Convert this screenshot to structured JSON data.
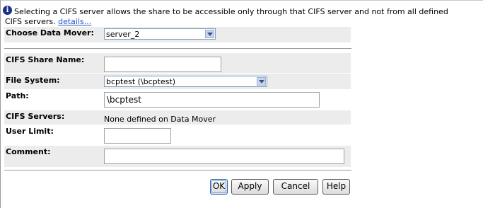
{
  "info": {
    "text_line1": "Selecting a CIFS server allows the share to be accessible only through that CIFS server and not from all defined",
    "text_line2": "CIFS servers.",
    "details_link": "details..."
  },
  "form": {
    "data_mover": {
      "label": "Choose Data Mover:",
      "value": "server_2"
    },
    "share_name": {
      "label": "CIFS Share Name:",
      "value": ""
    },
    "file_system": {
      "label": "File System:",
      "value": "bcptest (\\bcptest)"
    },
    "path": {
      "label": "Path:",
      "value": "\\bcptest"
    },
    "cifs_servers": {
      "label": "CIFS Servers:",
      "value": "None defined on Data Mover"
    },
    "user_limit": {
      "label": "User Limit:",
      "value": ""
    },
    "comment": {
      "label": "Comment:",
      "value": ""
    }
  },
  "buttons": {
    "ok": "OK",
    "apply": "Apply",
    "cancel": "Cancel",
    "help": "Help"
  },
  "icons": {
    "info": "info-icon",
    "dropdown": "chevron-down-icon"
  }
}
